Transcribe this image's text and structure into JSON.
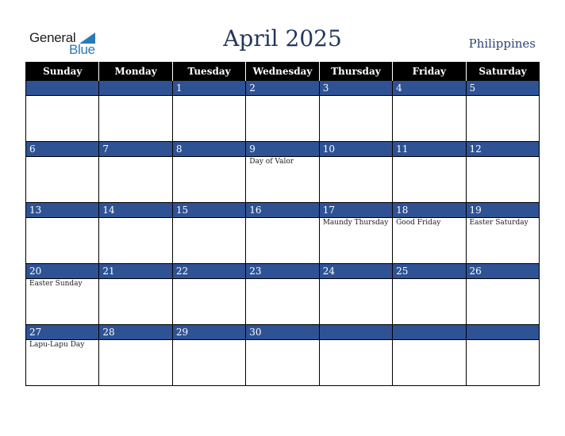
{
  "logo": {
    "line1": "General",
    "line2": "Blue"
  },
  "header": {
    "title": "April 2025",
    "country": "Philippines"
  },
  "colors": {
    "band": "#2e5294",
    "header_bg": "#000000",
    "title": "#23375c",
    "logo_blue": "#2a7ab8"
  },
  "weekdays": [
    "Sunday",
    "Monday",
    "Tuesday",
    "Wednesday",
    "Thursday",
    "Friday",
    "Saturday"
  ],
  "weeks": [
    [
      {
        "day": "",
        "holiday": ""
      },
      {
        "day": "",
        "holiday": ""
      },
      {
        "day": "1",
        "holiday": ""
      },
      {
        "day": "2",
        "holiday": ""
      },
      {
        "day": "3",
        "holiday": ""
      },
      {
        "day": "4",
        "holiday": ""
      },
      {
        "day": "5",
        "holiday": ""
      }
    ],
    [
      {
        "day": "6",
        "holiday": ""
      },
      {
        "day": "7",
        "holiday": ""
      },
      {
        "day": "8",
        "holiday": ""
      },
      {
        "day": "9",
        "holiday": "Day of Valor"
      },
      {
        "day": "10",
        "holiday": ""
      },
      {
        "day": "11",
        "holiday": ""
      },
      {
        "day": "12",
        "holiday": ""
      }
    ],
    [
      {
        "day": "13",
        "holiday": ""
      },
      {
        "day": "14",
        "holiday": ""
      },
      {
        "day": "15",
        "holiday": ""
      },
      {
        "day": "16",
        "holiday": ""
      },
      {
        "day": "17",
        "holiday": "Maundy Thursday"
      },
      {
        "day": "18",
        "holiday": "Good Friday"
      },
      {
        "day": "19",
        "holiday": "Easter Saturday"
      }
    ],
    [
      {
        "day": "20",
        "holiday": "Easter Sunday"
      },
      {
        "day": "21",
        "holiday": ""
      },
      {
        "day": "22",
        "holiday": ""
      },
      {
        "day": "23",
        "holiday": ""
      },
      {
        "day": "24",
        "holiday": ""
      },
      {
        "day": "25",
        "holiday": ""
      },
      {
        "day": "26",
        "holiday": ""
      }
    ],
    [
      {
        "day": "27",
        "holiday": "Lapu-Lapu Day"
      },
      {
        "day": "28",
        "holiday": ""
      },
      {
        "day": "29",
        "holiday": ""
      },
      {
        "day": "30",
        "holiday": ""
      },
      {
        "day": "",
        "holiday": ""
      },
      {
        "day": "",
        "holiday": ""
      },
      {
        "day": "",
        "holiday": ""
      }
    ]
  ]
}
